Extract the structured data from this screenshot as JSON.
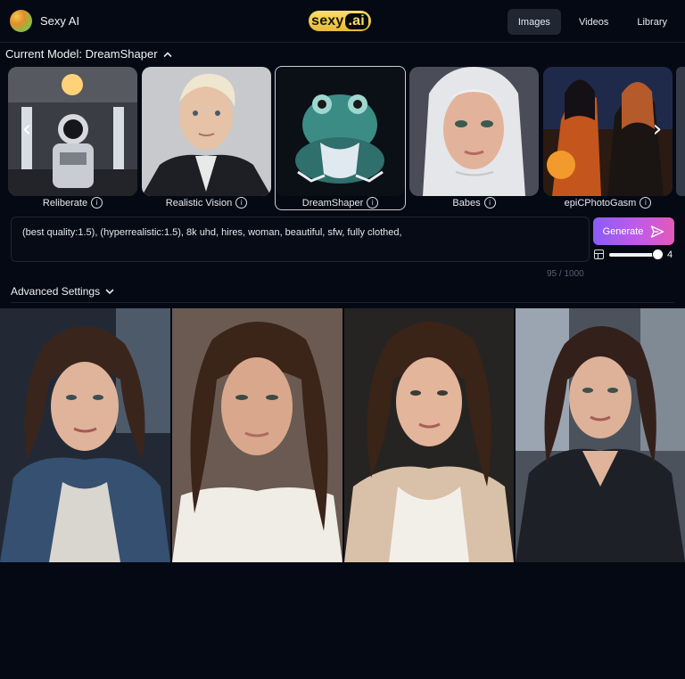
{
  "header": {
    "brand_name": "Sexy AI",
    "logo_text_main": "sexy",
    "logo_text_ai": ".ai",
    "nav": [
      {
        "label": "Images",
        "active": true
      },
      {
        "label": "Videos",
        "active": false
      },
      {
        "label": "Library",
        "active": false
      }
    ]
  },
  "model": {
    "current_label": "Current Model: DreamShaper",
    "cards": [
      {
        "label": "Reliberate",
        "selected": false
      },
      {
        "label": "Realistic Vision",
        "selected": false
      },
      {
        "label": "DreamShaper",
        "selected": true
      },
      {
        "label": "Babes",
        "selected": false
      },
      {
        "label": "epiCPhotoGasm",
        "selected": false
      }
    ]
  },
  "prompt": {
    "text": "(best quality:1.5), (hyperrealistic:1.5), 8k uhd, hires, woman, beautiful, sfw, fully clothed,",
    "counter": "95 / 1000"
  },
  "generate": {
    "label": "Generate"
  },
  "batch": {
    "value": "4"
  },
  "advanced": {
    "label": "Advanced Settings"
  },
  "colors": {
    "background": "#050913",
    "accent_gradient_start": "#8a5cf6",
    "accent_gradient_end": "#e45ab8",
    "logo_gold": "#f8df6a"
  }
}
